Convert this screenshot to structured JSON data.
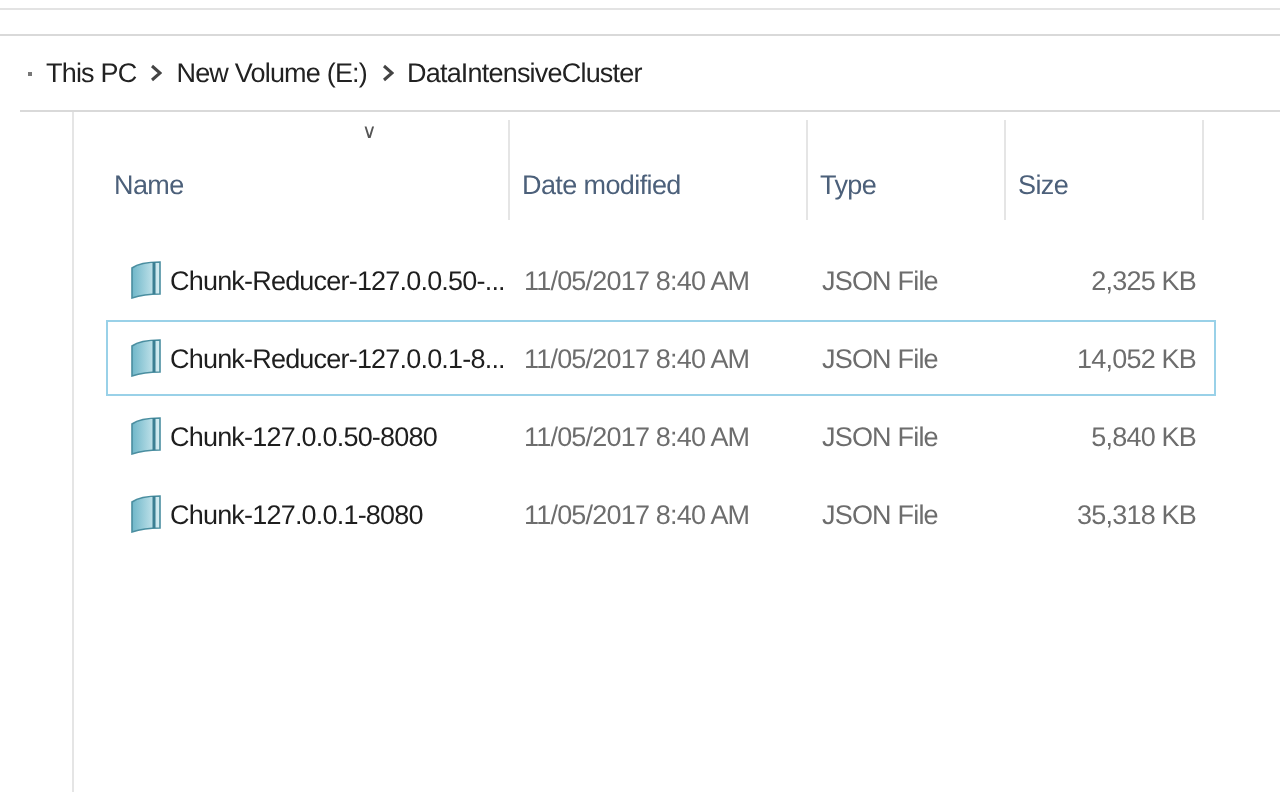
{
  "breadcrumb": [
    "This PC",
    "New Volume (E:)",
    "DataIntensiveCluster"
  ],
  "sort_indicator": "∨",
  "columns": [
    "Name",
    "Date modified",
    "Type",
    "Size"
  ],
  "rows": [
    {
      "name": "Chunk-Reducer-127.0.0.50-...",
      "date": "11/05/2017 8:40 AM",
      "type": "JSON File",
      "size": "2,325 KB",
      "focused": false
    },
    {
      "name": "Chunk-Reducer-127.0.0.1-8...",
      "date": "11/05/2017 8:40 AM",
      "type": "JSON File",
      "size": "14,052 KB",
      "focused": true
    },
    {
      "name": "Chunk-127.0.0.50-8080",
      "date": "11/05/2017 8:40 AM",
      "type": "JSON File",
      "size": "5,840 KB",
      "focused": false
    },
    {
      "name": "Chunk-127.0.0.1-8080",
      "date": "11/05/2017 8:40 AM",
      "type": "JSON File",
      "size": "35,318 KB",
      "focused": false
    }
  ]
}
